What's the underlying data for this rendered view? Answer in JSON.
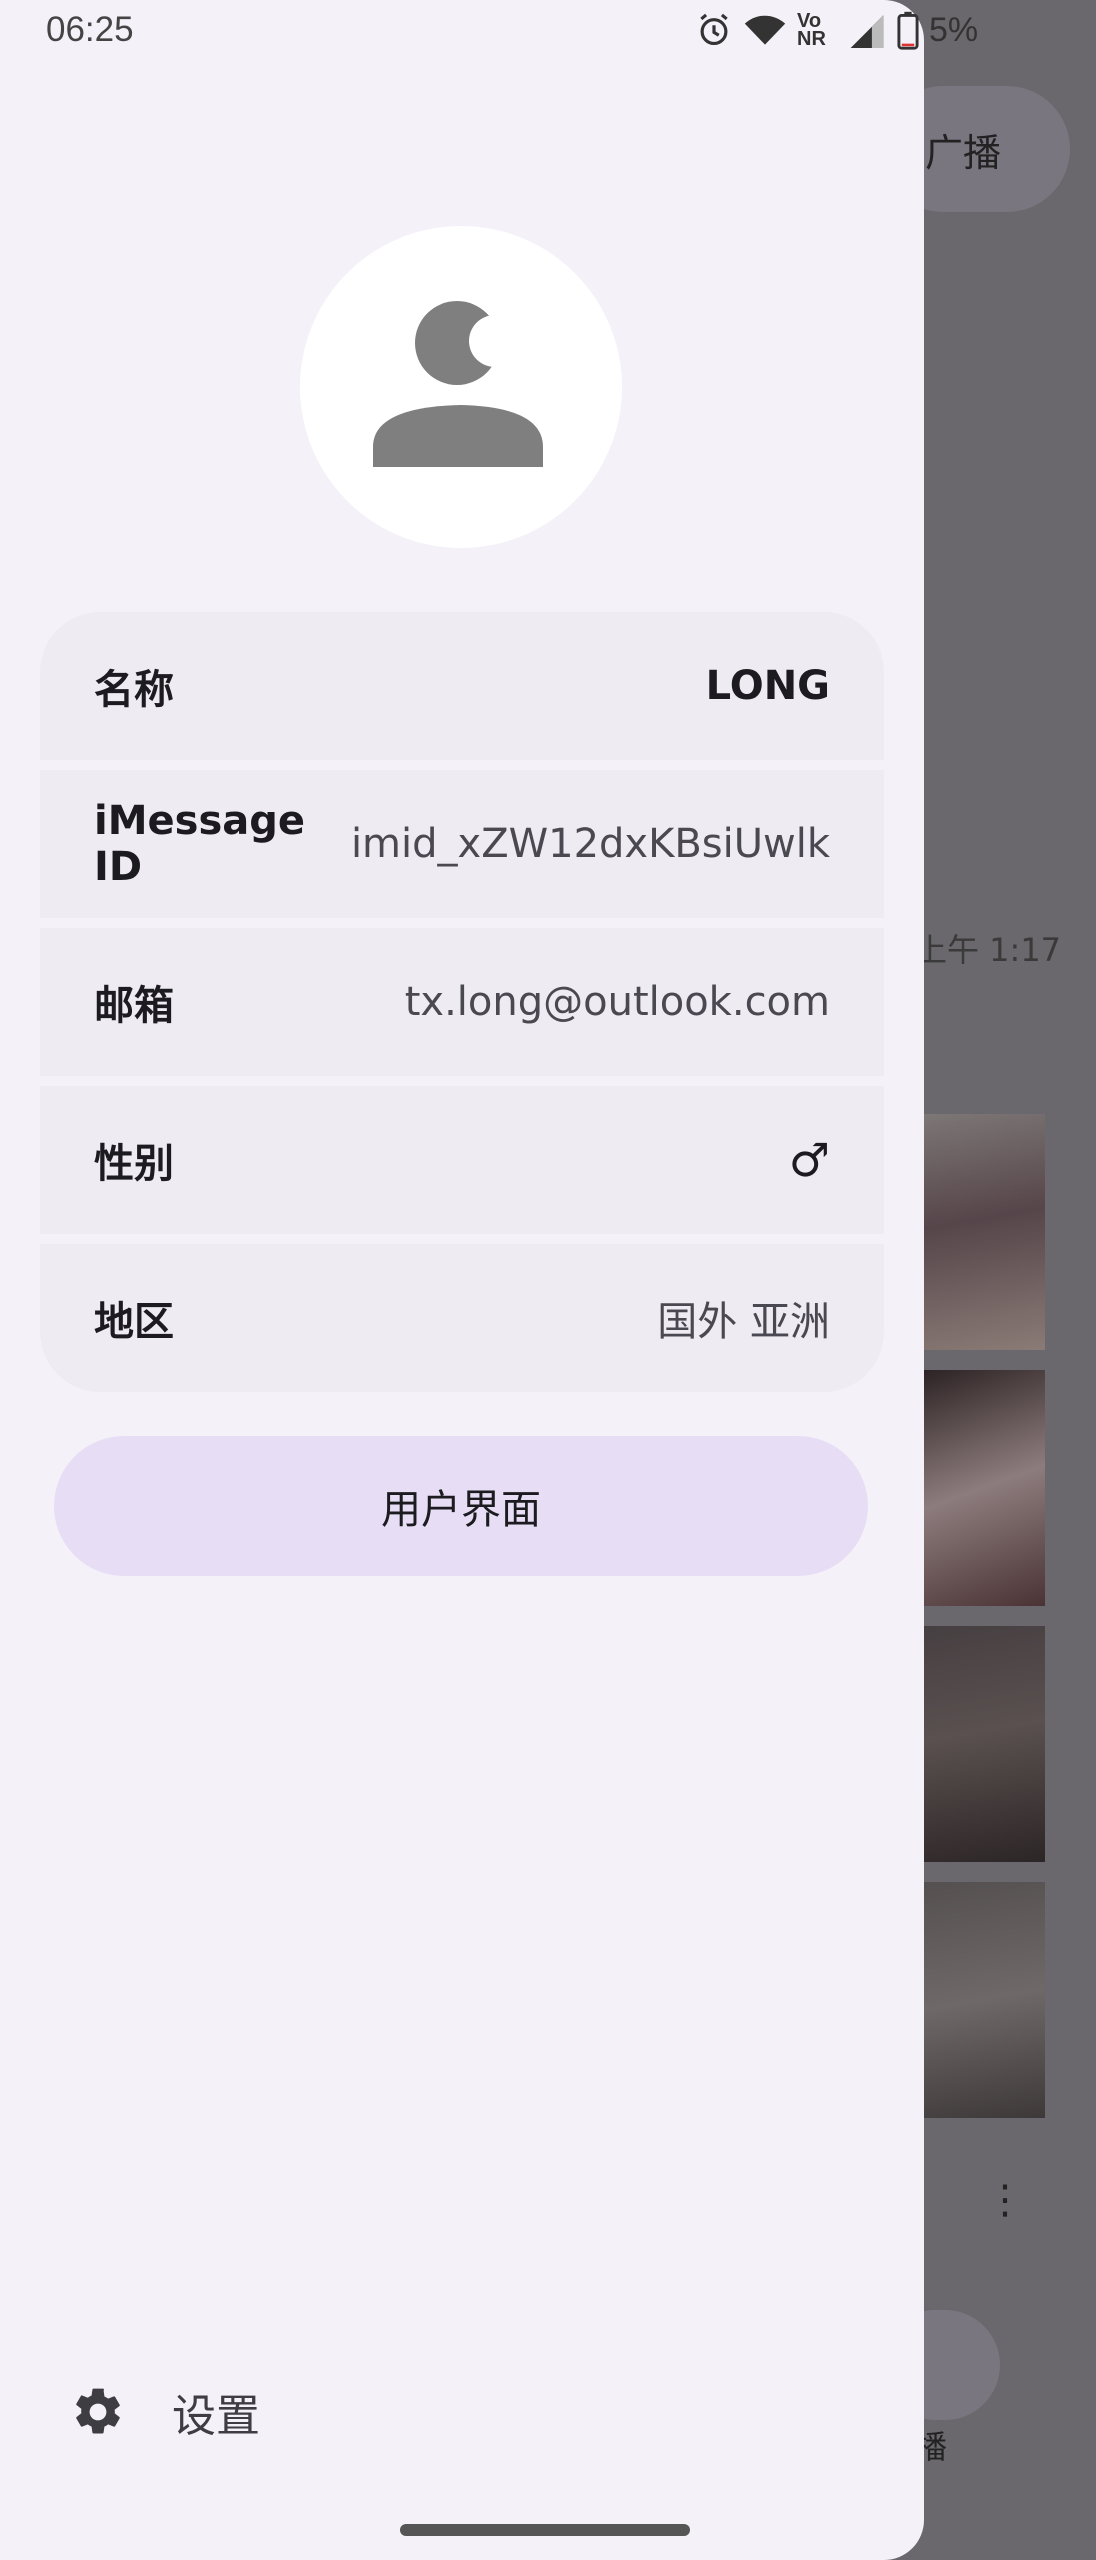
{
  "status_bar": {
    "time": "06:25",
    "network_label": "Vo NR",
    "battery_percent": "5%"
  },
  "background_app": {
    "pill_label": "广播",
    "timestamp": "上午 1:17",
    "fab_label": "播"
  },
  "drawer": {
    "profile_rows": [
      {
        "label": "名称",
        "value": "LONG"
      },
      {
        "label": "iMessage ID",
        "value": "imid_xZW12dxKBsiUwlk"
      },
      {
        "label": "邮箱",
        "value": "tx.long@outlook.com"
      },
      {
        "label": "性别",
        "value": "♂"
      },
      {
        "label": "地区",
        "value": "国外 亚洲"
      }
    ],
    "user_ui_button": "用户界面",
    "settings_label": "设置"
  },
  "colors": {
    "drawer_bg": "#f4f1f8",
    "row_bg": "#efebf3",
    "button_bg": "#e7def6",
    "scrim": "#6a686c"
  }
}
